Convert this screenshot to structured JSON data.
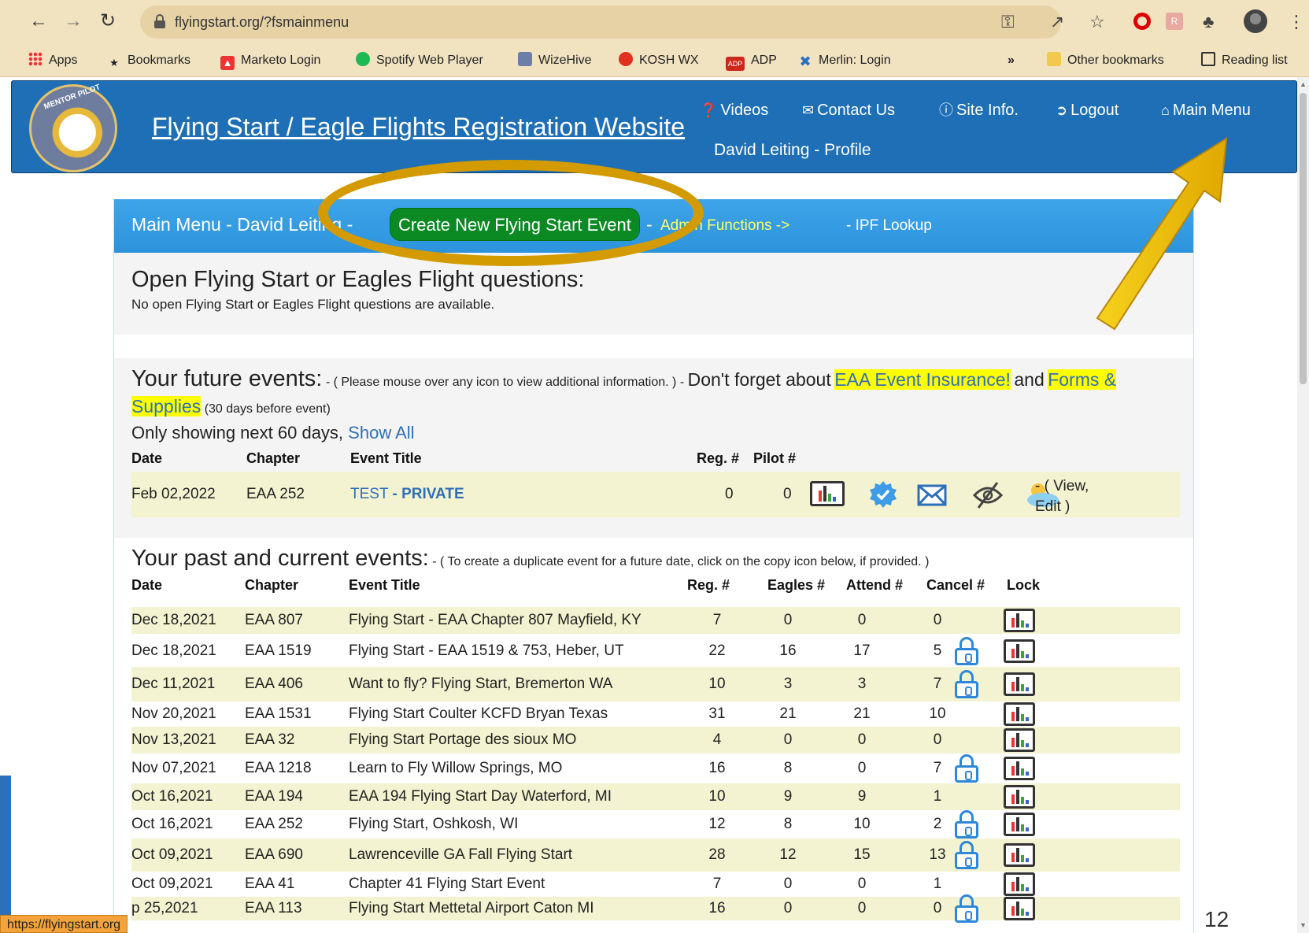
{
  "browser": {
    "url": "flyingstart.org/?fsmainmenu",
    "bookmarks": [
      "Apps",
      "Bookmarks",
      "Marketo Login",
      "Spotify Web Player",
      "WizeHive",
      "KOSH WX",
      "ADP",
      "Merlin: Login"
    ],
    "overflow": "»",
    "other_bookmarks": "Other bookmarks",
    "reading_list": "Reading list",
    "status_url": "https://flyingstart.org"
  },
  "header": {
    "site_title": "Flying Start / Eagle Flights Registration Website",
    "nav": [
      {
        "label": "Videos",
        "icon": "question-circle-icon"
      },
      {
        "label": "Contact Us",
        "icon": "envelope-icon"
      },
      {
        "label": "Site Info.",
        "icon": "info-circle-icon"
      },
      {
        "label": "Logout",
        "icon": "logout-icon"
      },
      {
        "label": "Main Menu",
        "icon": "home-icon"
      }
    ],
    "profile": "David Leiting - Profile"
  },
  "panel_header": {
    "main_menu_text": "Main Menu - David Leiting -",
    "create_button": "Create New Flying Start Event",
    "sep": "-",
    "admin_link": "Admin Functions ->",
    "ipf_link": "- IPF Lookup"
  },
  "open_questions": {
    "heading": "Open Flying Start or Eagles Flight questions:",
    "message": "No open Flying Start or Eagles Flight questions are available."
  },
  "future_events": {
    "heading": "Your future events:",
    "note": "- ( Please mouse over any icon to view additional information. ) -",
    "reminder": "Don't forget about",
    "insurance_link": "EAA Event Insurance!",
    "and": "and",
    "forms_link_1": "Forms &",
    "forms_link_2": "Supplies",
    "days_note": "(30 days before event)",
    "showing": "Only showing next 60 days,",
    "show_all": "Show All",
    "columns": [
      "Date",
      "Chapter",
      "Event Title",
      "Reg. #",
      "Pilot #"
    ],
    "rows": [
      {
        "date": "Feb 02,2022",
        "chapter": "EAA 252",
        "title": "TEST",
        "private": "- PRIVATE",
        "reg": "0",
        "pilot": "0",
        "view_edit_1": "- ( View,",
        "view_edit_2": "Edit )"
      }
    ]
  },
  "past_events": {
    "heading": "Your past and current events:",
    "note": "- ( To create a duplicate event for a future date, click on the copy icon below, if provided. )",
    "columns": [
      "Date",
      "Chapter",
      "Event Title",
      "Reg. #",
      "Eagles #",
      "Attend #",
      "Cancel #",
      "Lock"
    ],
    "rows": [
      {
        "date": "Dec 18,2021",
        "chapter": "EAA 807",
        "title": "Flying Start - EAA Chapter 807 Mayfield, KY",
        "reg": "7",
        "eagles": "0",
        "attend": "0",
        "cancel": "0",
        "locked": false
      },
      {
        "date": "Dec 18,2021",
        "chapter": "EAA 1519",
        "title": "Flying Start - EAA 1519 & 753, Heber, UT",
        "reg": "22",
        "eagles": "16",
        "attend": "17",
        "cancel": "5",
        "locked": true
      },
      {
        "date": "Dec 11,2021",
        "chapter": "EAA 406",
        "title": "Want to fly? Flying Start, Bremerton WA",
        "reg": "10",
        "eagles": "3",
        "attend": "3",
        "cancel": "7",
        "locked": true
      },
      {
        "date": "Nov 20,2021",
        "chapter": "EAA 1531",
        "title": "Flying Start Coulter KCFD Bryan Texas",
        "reg": "31",
        "eagles": "21",
        "attend": "21",
        "cancel": "10",
        "locked": false
      },
      {
        "date": "Nov 13,2021",
        "chapter": "EAA 32",
        "title": "Flying Start Portage des sioux MO",
        "reg": "4",
        "eagles": "0",
        "attend": "0",
        "cancel": "0",
        "locked": false
      },
      {
        "date": "Nov 07,2021",
        "chapter": "EAA 1218",
        "title": "Learn to Fly Willow Springs, MO",
        "reg": "16",
        "eagles": "8",
        "attend": "0",
        "cancel": "7",
        "locked": true
      },
      {
        "date": "Oct 16,2021",
        "chapter": "EAA 194",
        "title": "EAA 194 Flying Start Day Waterford, MI",
        "reg": "10",
        "eagles": "9",
        "attend": "9",
        "cancel": "1",
        "locked": false
      },
      {
        "date": "Oct 16,2021",
        "chapter": "EAA 252",
        "title": "Flying Start, Oshkosh, WI",
        "reg": "12",
        "eagles": "8",
        "attend": "10",
        "cancel": "2",
        "locked": true
      },
      {
        "date": "Oct 09,2021",
        "chapter": "EAA 690",
        "title": "Lawrenceville GA Fall Flying Start",
        "reg": "28",
        "eagles": "12",
        "attend": "15",
        "cancel": "13",
        "locked": true
      },
      {
        "date": "Oct 09,2021",
        "chapter": "EAA 41",
        "title": "Chapter 41 Flying Start Event",
        "reg": "7",
        "eagles": "0",
        "attend": "0",
        "cancel": "1",
        "locked": false
      },
      {
        "date": "p 25,2021",
        "chapter": "EAA 113",
        "title": "Flying Start Mettetal Airport Caton MI",
        "reg": "16",
        "eagles": "0",
        "attend": "0",
        "cancel": "0",
        "locked": true
      }
    ]
  },
  "page_number": "12",
  "colors": {
    "header_blue": "#1e6fb5",
    "panel_blue": "#3ea5e9",
    "create_green": "#0b8a24",
    "link_blue": "#2f6fb8",
    "highlight_yellow": "#ffff00",
    "row_tint": "#f3f3d1",
    "annotation_gold": "#d49b00"
  }
}
